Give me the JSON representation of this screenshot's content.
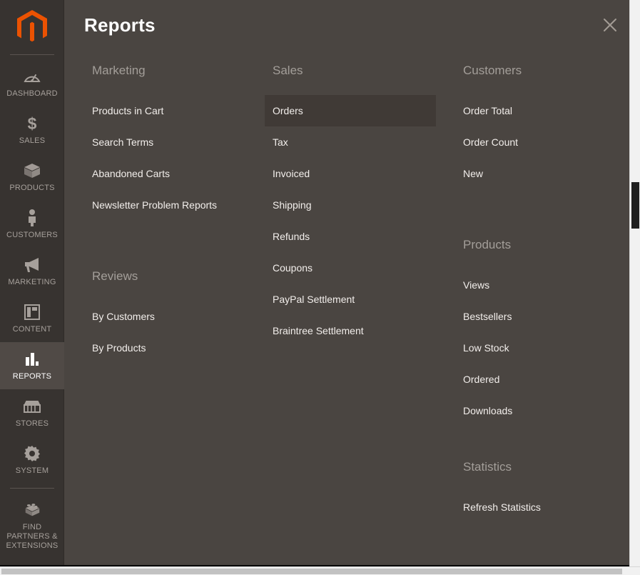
{
  "sidebar": {
    "logo": "magento-logo",
    "items": [
      {
        "label": "DASHBOARD",
        "icon": "dashboard-icon",
        "active": false
      },
      {
        "label": "SALES",
        "icon": "dollar-icon",
        "active": false
      },
      {
        "label": "PRODUCTS",
        "icon": "box-icon",
        "active": false
      },
      {
        "label": "CUSTOMERS",
        "icon": "person-icon",
        "active": false
      },
      {
        "label": "MARKETING",
        "icon": "megaphone-icon",
        "active": false
      },
      {
        "label": "CONTENT",
        "icon": "layout-icon",
        "active": false
      },
      {
        "label": "REPORTS",
        "icon": "bar-chart-icon",
        "active": true
      },
      {
        "label": "STORES",
        "icon": "storefront-icon",
        "active": false
      },
      {
        "label": "SYSTEM",
        "icon": "gear-icon",
        "active": false
      },
      {
        "label": "FIND PARTNERS & EXTENSIONS",
        "icon": "puzzle-brick-icon",
        "active": false
      }
    ]
  },
  "panel": {
    "title": "Reports",
    "close_icon": "close-icon",
    "columns": [
      {
        "groups": [
          {
            "title": "Marketing",
            "items": [
              {
                "label": "Products in Cart",
                "highlight": false
              },
              {
                "label": "Search Terms",
                "highlight": false
              },
              {
                "label": "Abandoned Carts",
                "highlight": false
              },
              {
                "label": "Newsletter Problem Reports",
                "highlight": false
              }
            ]
          },
          {
            "title": "Reviews",
            "items": [
              {
                "label": "By Customers",
                "highlight": false
              },
              {
                "label": "By Products",
                "highlight": false
              }
            ]
          }
        ]
      },
      {
        "groups": [
          {
            "title": "Sales",
            "items": [
              {
                "label": "Orders",
                "highlight": true
              },
              {
                "label": "Tax",
                "highlight": false
              },
              {
                "label": "Invoiced",
                "highlight": false
              },
              {
                "label": "Shipping",
                "highlight": false
              },
              {
                "label": "Refunds",
                "highlight": false
              },
              {
                "label": "Coupons",
                "highlight": false
              },
              {
                "label": "PayPal Settlement",
                "highlight": false
              },
              {
                "label": "Braintree Settlement",
                "highlight": false
              }
            ]
          }
        ]
      },
      {
        "groups": [
          {
            "title": "Customers",
            "items": [
              {
                "label": "Order Total",
                "highlight": false
              },
              {
                "label": "Order Count",
                "highlight": false
              },
              {
                "label": "New",
                "highlight": false
              }
            ]
          },
          {
            "title": "Products",
            "items": [
              {
                "label": "Views",
                "highlight": false
              },
              {
                "label": "Bestsellers",
                "highlight": false
              },
              {
                "label": "Low Stock",
                "highlight": false
              },
              {
                "label": "Ordered",
                "highlight": false
              },
              {
                "label": "Downloads",
                "highlight": false
              }
            ]
          },
          {
            "title": "Statistics",
            "items": [
              {
                "label": "Refresh Statistics",
                "highlight": false
              }
            ]
          }
        ]
      }
    ]
  },
  "scrollbars": {
    "vertical": "vertical-scrollbar",
    "horizontal": "horizontal-scrollbar"
  },
  "colors": {
    "sidebar_bg": "#373330",
    "panel_bg": "#4a4541",
    "accent_orange": "#eb5202",
    "highlight_bg": "#403a36",
    "group_title": "#a39e99",
    "link_text": "#f2eeeb"
  }
}
